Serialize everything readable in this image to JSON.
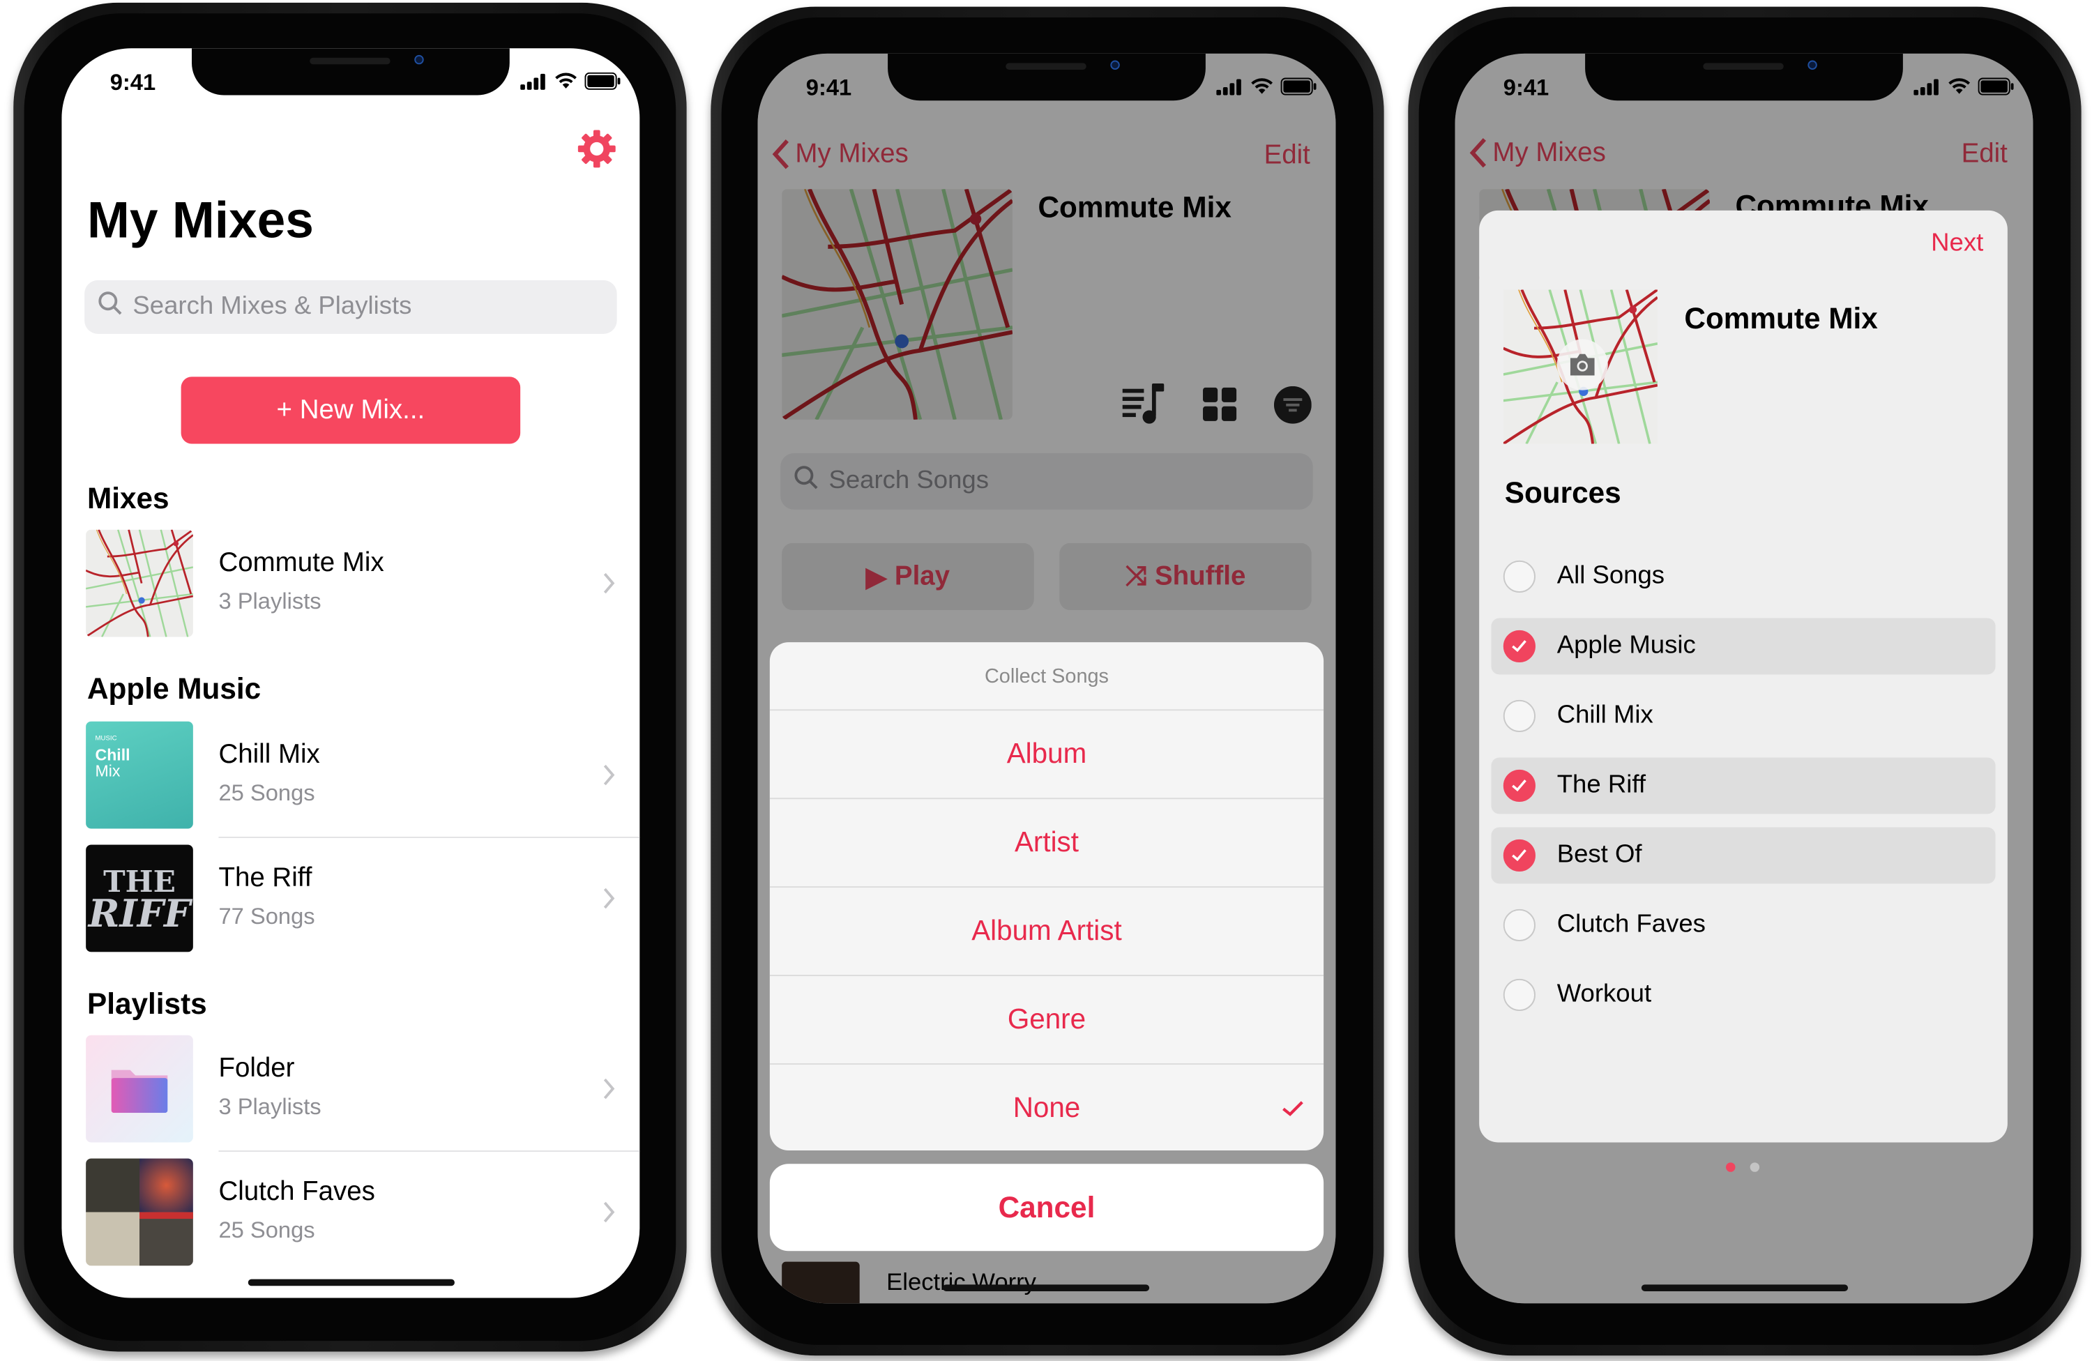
{
  "status_time": "9:41",
  "screen1": {
    "title": "My Mixes",
    "search_placeholder": "Search Mixes & Playlists",
    "new_mix_label": "+ New Mix...",
    "sections": [
      {
        "header": "Mixes",
        "items": [
          {
            "title": "Commute Mix",
            "subtitle": "3 Playlists",
            "art": "map"
          }
        ]
      },
      {
        "header": "Apple Music",
        "items": [
          {
            "title": "Chill Mix",
            "subtitle": "25 Songs",
            "art": "chill"
          },
          {
            "title": "The Riff",
            "subtitle": "77 Songs",
            "art": "riff"
          }
        ]
      },
      {
        "header": "Playlists",
        "items": [
          {
            "title": "Folder",
            "subtitle": "3 Playlists",
            "art": "folder"
          },
          {
            "title": "Clutch Faves",
            "subtitle": "25 Songs",
            "art": "collage"
          }
        ]
      }
    ],
    "chill_art": {
      "brand": "MUSIC",
      "line1": "Chill",
      "line2": "Mix"
    },
    "riff_art": {
      "line1": "THE",
      "line2": "RIFF"
    },
    "icons": {
      "settings": "gear-icon",
      "search": "search-icon",
      "chevron": "chevron-right-icon"
    }
  },
  "screen2": {
    "back_label": "My Mixes",
    "edit_label": "Edit",
    "mix_title": "Commute Mix",
    "search_placeholder": "Search Songs",
    "play_label": "Play",
    "shuffle_label": "Shuffle",
    "sheet": {
      "title": "Collect Songs",
      "options": [
        "Album",
        "Artist",
        "Album Artist",
        "Genre",
        "None"
      ],
      "selected": "None",
      "cancel_label": "Cancel"
    },
    "peek_song": "Electric Worry"
  },
  "screen3": {
    "back_label": "My Mixes",
    "edit_label": "Edit",
    "behind_title": "Commute Mix",
    "next_label": "Next",
    "mix_title": "Commute Mix",
    "sources_header": "Sources",
    "sources": [
      {
        "label": "All Songs",
        "checked": false
      },
      {
        "label": "Apple Music",
        "checked": true
      },
      {
        "label": "Chill Mix",
        "checked": false
      },
      {
        "label": "The Riff",
        "checked": true
      },
      {
        "label": "Best Of",
        "checked": true
      },
      {
        "label": "Clutch Faves",
        "checked": false
      },
      {
        "label": "Workout",
        "checked": false
      }
    ],
    "page_count": 2,
    "current_page": 1
  },
  "colors": {
    "accent": "#f0455f",
    "destructive_text": "#e8294c",
    "secondary_text": "#8e8e93"
  }
}
